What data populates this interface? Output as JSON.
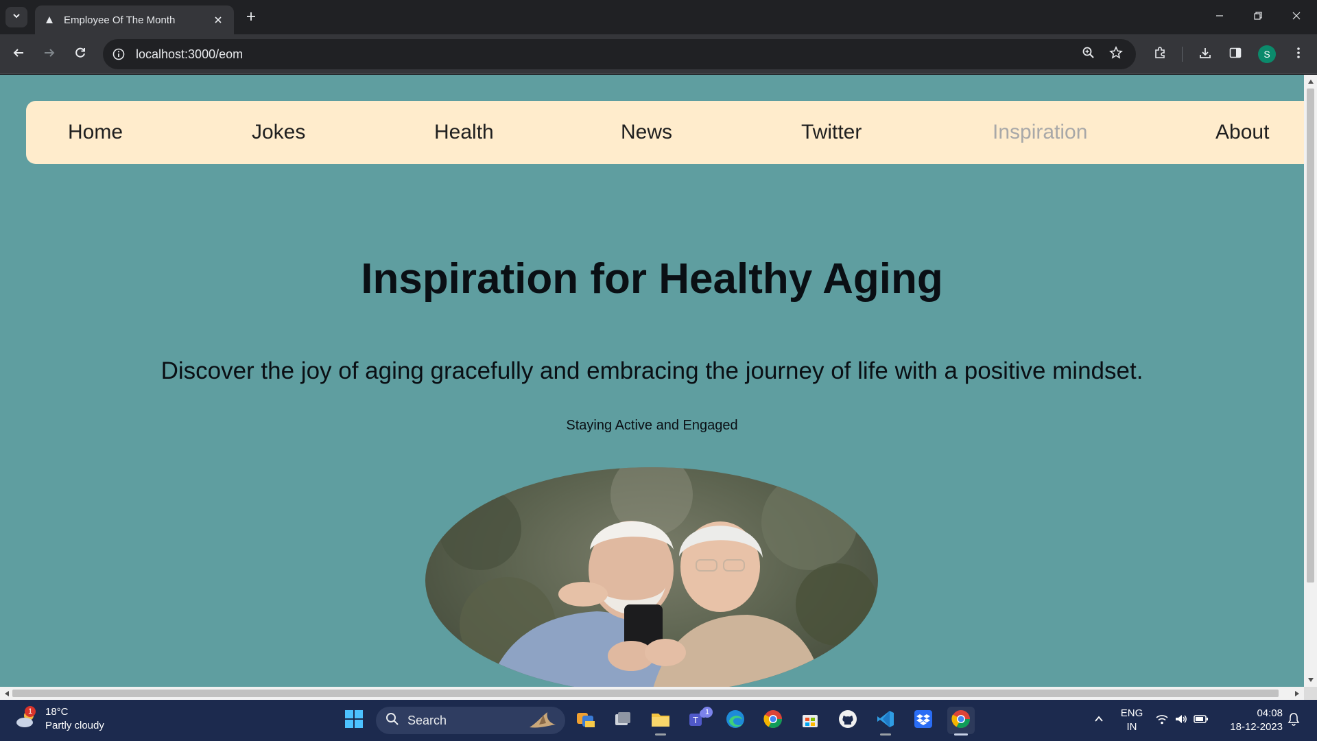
{
  "browser": {
    "tab_title": "Employee Of The Month",
    "url": "localhost:3000/eom",
    "profile_initial": "S"
  },
  "page": {
    "nav": [
      {
        "label": "Home",
        "active": false
      },
      {
        "label": "Jokes",
        "active": false
      },
      {
        "label": "Health",
        "active": false
      },
      {
        "label": "News",
        "active": false
      },
      {
        "label": "Twitter",
        "active": false
      },
      {
        "label": "Inspiration",
        "active": true
      },
      {
        "label": "About",
        "active": false
      }
    ],
    "headline": "Inspiration for Healthy Aging",
    "tagline": "Discover the joy of aging gracefully and embracing the journey of life with a positive mindset.",
    "subhead": "Staying Active and Engaged",
    "image_subject": "elderly-couple-with-phone"
  },
  "taskbar": {
    "weather_temp": "18°C",
    "weather_cond": "Partly cloudy",
    "weather_badge": "1",
    "search_placeholder": "Search",
    "teams_badge": "1",
    "lang_line1": "ENG",
    "lang_line2": "IN",
    "time": "04:08",
    "date": "18-12-2023"
  },
  "colors": {
    "page_bg": "#5f9ea0",
    "navbar_bg": "#ffeccc",
    "nav_active": "#a8a8a8",
    "taskbar_bg": "#1c2a4e"
  }
}
